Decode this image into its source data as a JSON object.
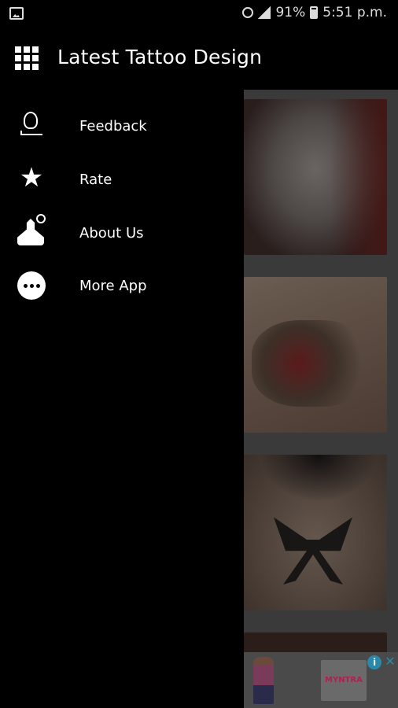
{
  "status_bar": {
    "battery_percent": "91%",
    "time": "5:51 p.m."
  },
  "app_bar": {
    "title": "Latest Tattoo Design"
  },
  "drawer": {
    "items": [
      {
        "label": "Feedback",
        "icon": "feedback-icon"
      },
      {
        "label": "Rate",
        "icon": "star-icon"
      },
      {
        "label": "About Us",
        "icon": "about-us-icon"
      },
      {
        "label": "More App",
        "icon": "more-icon"
      }
    ]
  },
  "ad": {
    "brand": "MYNTRA",
    "info_icon": "info-icon",
    "close_icon": "close-icon"
  },
  "colors": {
    "background": "#000000",
    "text": "#ffffff",
    "ad_accent": "#2a89a8"
  }
}
